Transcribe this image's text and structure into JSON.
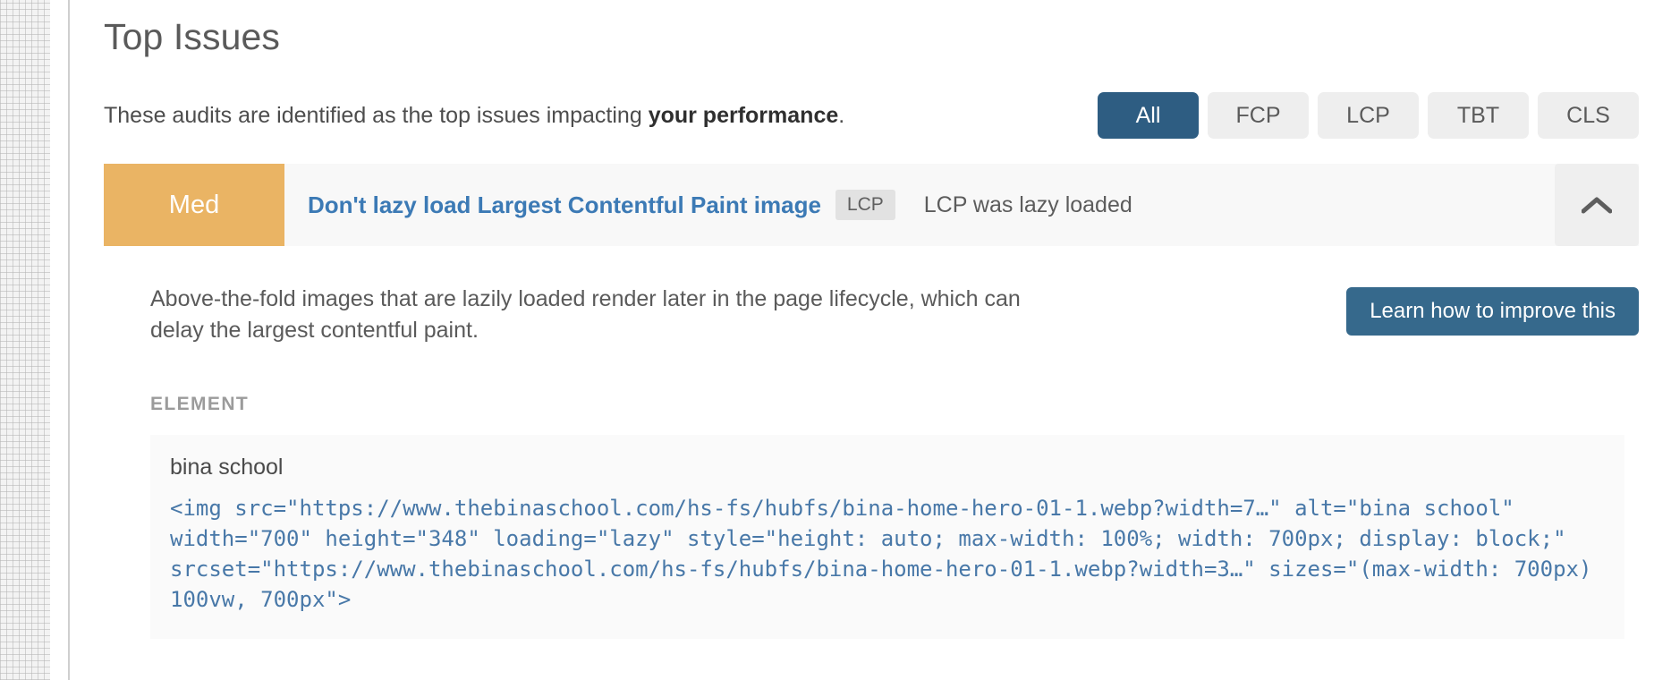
{
  "header": {
    "title": "Top Issues",
    "subtitle_prefix": "These audits are identified as the top issues impacting ",
    "subtitle_bold": "your performance",
    "subtitle_suffix": "."
  },
  "filters": [
    {
      "label": "All",
      "active": true
    },
    {
      "label": "FCP",
      "active": false
    },
    {
      "label": "LCP",
      "active": false
    },
    {
      "label": "TBT",
      "active": false
    },
    {
      "label": "CLS",
      "active": false
    }
  ],
  "issue": {
    "severity": "Med",
    "severity_color": "#eab464",
    "title": "Don't lazy load Largest Contentful Paint image",
    "metric_tag": "LCP",
    "summary": "LCP was lazy loaded",
    "collapse_icon": "chevron-up-icon",
    "description": "Above-the-fold images that are lazily loaded render later in the page lifecycle, which can delay the largest contentful paint.",
    "learn_button": "Learn how to improve this",
    "section_label": "ELEMENT",
    "element": {
      "alt_text": "bina school",
      "html": "<img src=\"https://www.thebinaschool.com/hs-fs/hubfs/bina-home-hero-01-1.webp?width=7…\" alt=\"bina school\" width=\"700\" height=\"348\" loading=\"lazy\" style=\"height: auto; max-width: 100%; width: 700px; display: block;\" srcset=\"https://www.thebinaschool.com/hs-fs/hubfs/bina-home-hero-01-1.webp?width=3…\" sizes=\"(max-width: 700px) 100vw, 700px\">"
    }
  },
  "colors": {
    "accent_blue": "#2e5d82",
    "link_blue": "#3c7ab5",
    "button_blue": "#36698c",
    "code_blue": "#4878a8",
    "severity_med": "#eab464"
  }
}
